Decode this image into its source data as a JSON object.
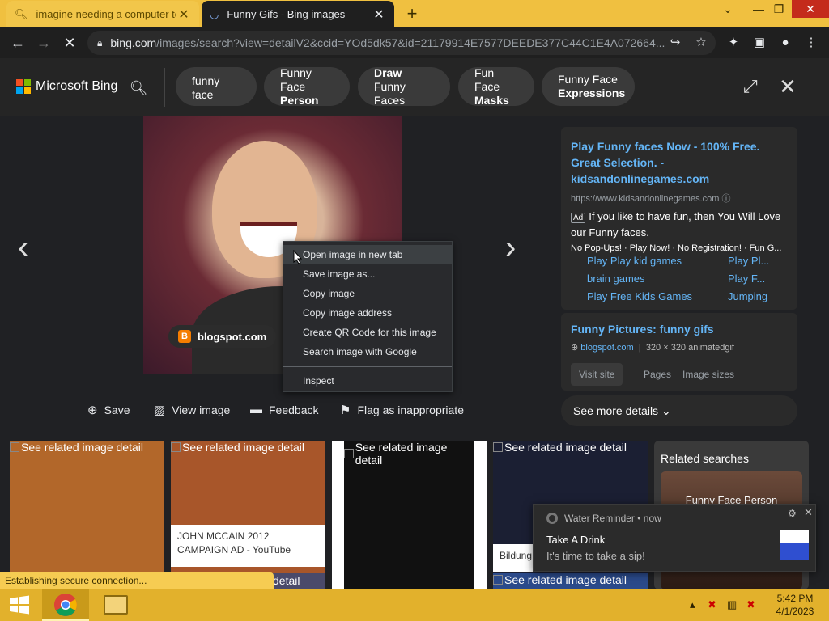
{
  "tabs": [
    {
      "title": "imagine needing a computer to f",
      "icon": "search-icon",
      "close": "✕"
    },
    {
      "title": "Funny Gifs - Bing images",
      "icon": "loading-spinner-icon",
      "close": "✕"
    }
  ],
  "new_tab": "+",
  "address": {
    "host": "bing.com",
    "path": "/images/search?view=detailV2&ccid=YOd5dk57&id=21179914E7577DEEDE377C44C1E4A072664..."
  },
  "bing": {
    "logo_text": "Microsoft Bing",
    "pills": [
      {
        "line1": "funny face",
        "line2": "",
        "bold": ""
      },
      {
        "line1": "Funny Face",
        "line2": "Person",
        "bold": "line2"
      },
      {
        "line1": "Draw",
        "line2": "Funny Faces",
        "bold": "line1"
      },
      {
        "line1": "Fun Face",
        "line2": "Masks",
        "bold": "line2"
      },
      {
        "line1": "Funny Face",
        "line2": "Expressions",
        "bold": "line2"
      }
    ]
  },
  "viewer": {
    "source": "blogspot.com",
    "actions": {
      "save": "Save",
      "view": "View image",
      "feedback": "Feedback",
      "flag": "Flag as inappropriate"
    }
  },
  "ad": {
    "title": "Play Funny faces Now - 100% Free. Great Selection. - kidsandonlinegames.com",
    "url": "https://www.kidsandonlinegames.com",
    "badge": "Ad",
    "desc": "If you like to have fun, then You Will Love our Funny faces.",
    "features": "No Pop-Ups! · Play Now! · No Registration! · Fun G...",
    "links": [
      "Play Play kid games",
      "Play Pl...",
      "brain games",
      "Play F...",
      "Play Free Kids Games",
      "Jumping"
    ]
  },
  "info": {
    "title": "Funny Pictures: funny gifs",
    "site": "blogspot.com",
    "meta": "320 × 320 animatedgif",
    "buttons": [
      "Visit site",
      "Pages",
      "Image sizes"
    ],
    "more": "See more details"
  },
  "context_menu": {
    "items": [
      "Open image in new tab",
      "Save image as...",
      "Copy image",
      "Copy image address",
      "Create QR Code for this image",
      "Search image with Google"
    ],
    "inspect": "Inspect"
  },
  "related": {
    "alt": "See related image detail",
    "caption": "JOHN MCCAIN 2012 CAMPAIGN AD - YouTube",
    "partial_caption": "Bildung",
    "partial_detail": "detail",
    "searches_title": "Related searches",
    "searches_label": "Funny Face Person"
  },
  "notification": {
    "app": "Water Reminder",
    "time": "now",
    "title": "Take A Drink",
    "body": "It's time to take a sip!"
  },
  "status": "Establishing secure connection...",
  "clock": {
    "time": "5:42 PM",
    "date": "4/1/2023"
  }
}
